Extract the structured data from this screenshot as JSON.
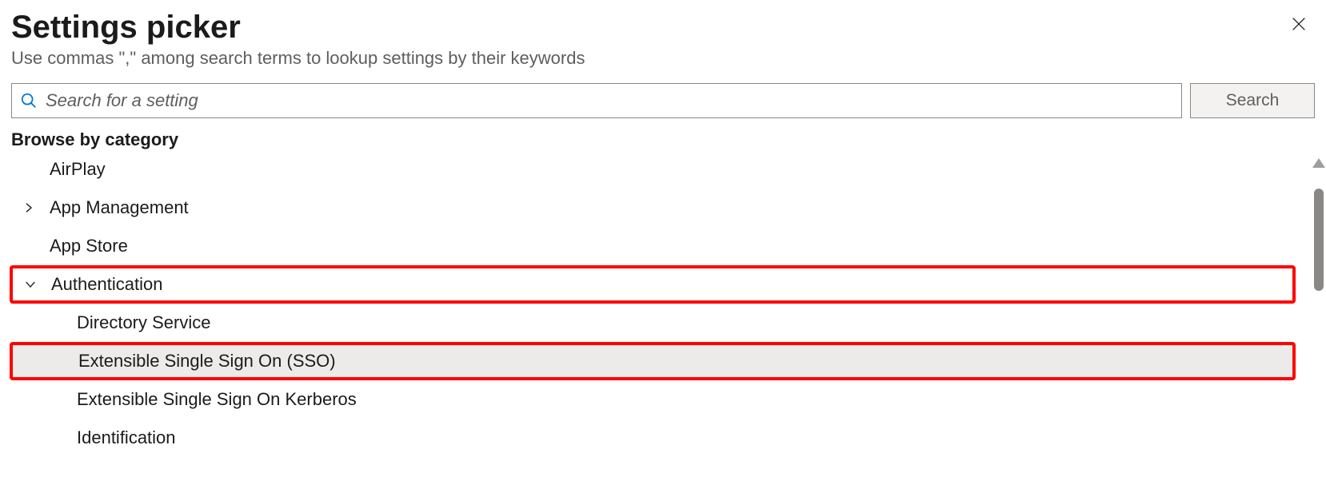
{
  "header": {
    "title": "Settings picker",
    "subtitle": "Use commas \",\" among search terms to lookup settings by their keywords"
  },
  "search": {
    "placeholder": "Search for a setting",
    "button_label": "Search"
  },
  "browse_label": "Browse by category",
  "categories": [
    {
      "label": "AirPlay",
      "expandable": false
    },
    {
      "label": "App Management",
      "expandable": true,
      "expanded": false
    },
    {
      "label": "App Store",
      "expandable": false
    },
    {
      "label": "Authentication",
      "expandable": true,
      "expanded": true,
      "highlighted": true,
      "children": [
        {
          "label": "Directory Service"
        },
        {
          "label": "Extensible Single Sign On (SSO)",
          "selected": true,
          "highlighted": true
        },
        {
          "label": "Extensible Single Sign On Kerberos"
        },
        {
          "label": "Identification"
        }
      ]
    }
  ]
}
